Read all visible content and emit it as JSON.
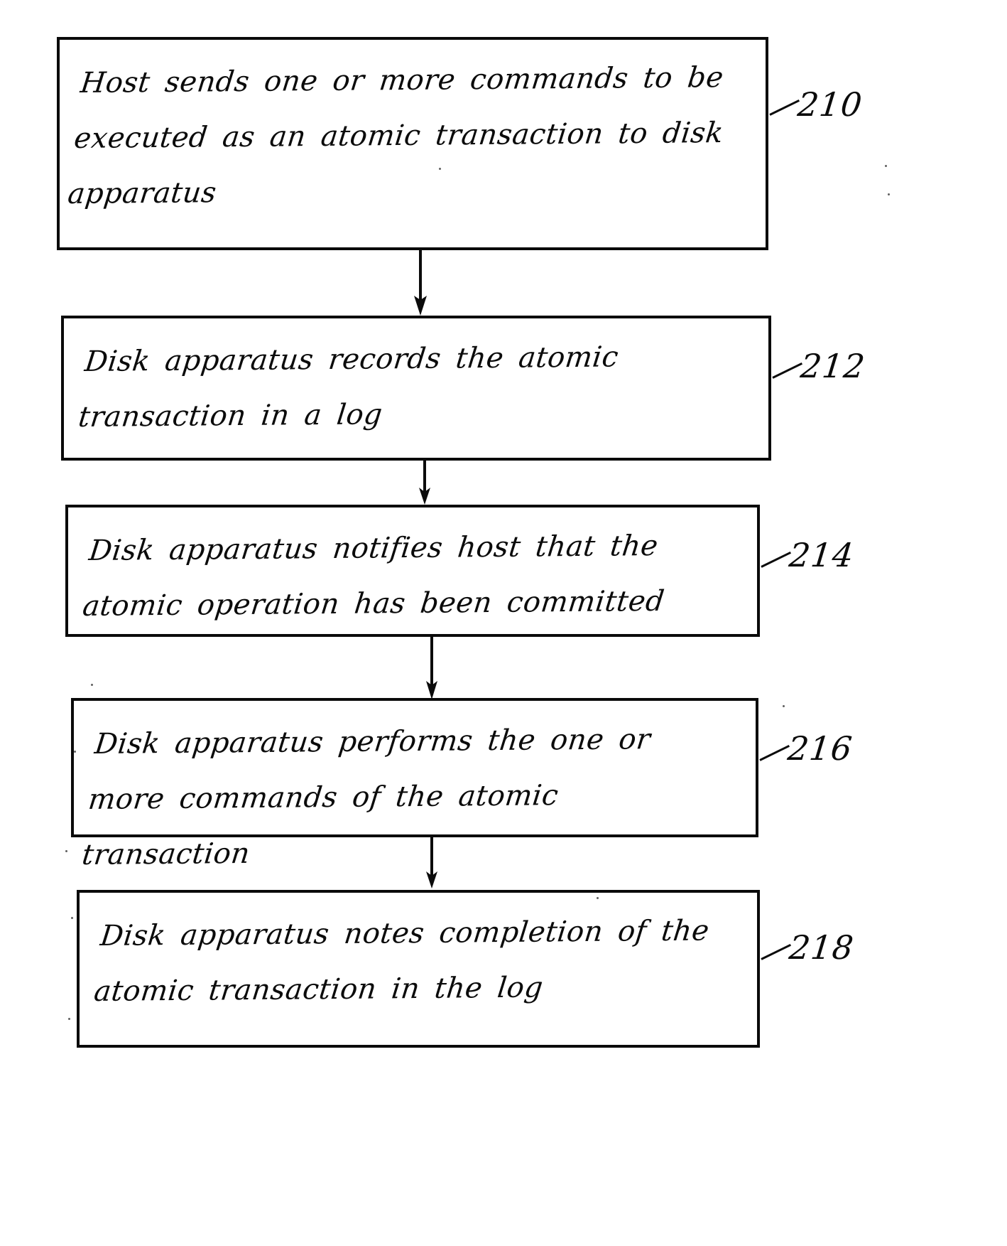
{
  "figure": {
    "type": "flowchart",
    "orientation": "vertical",
    "style": "hand-drawn patent figure",
    "ink_color": "#0b0b0b",
    "background_color": "#ffffff",
    "steps": [
      {
        "ref": "210",
        "text": "Host sends one or more commands to be executed as an atomic transaction to disk apparatus"
      },
      {
        "ref": "212",
        "text": "Disk apparatus records the atomic transaction in a log"
      },
      {
        "ref": "214",
        "text": "Disk apparatus notifies host that the atomic operation has been committed"
      },
      {
        "ref": "216",
        "text": "Disk apparatus performs the one or more commands of the atomic transaction"
      },
      {
        "ref": "218",
        "text": "Disk apparatus notes completion of the atomic transaction in the log"
      }
    ],
    "connectors": [
      {
        "from": "210",
        "to": "212",
        "arrow": "down"
      },
      {
        "from": "212",
        "to": "214",
        "arrow": "down"
      },
      {
        "from": "214",
        "to": "216",
        "arrow": "down"
      },
      {
        "from": "216",
        "to": "218",
        "arrow": "down"
      }
    ]
  }
}
